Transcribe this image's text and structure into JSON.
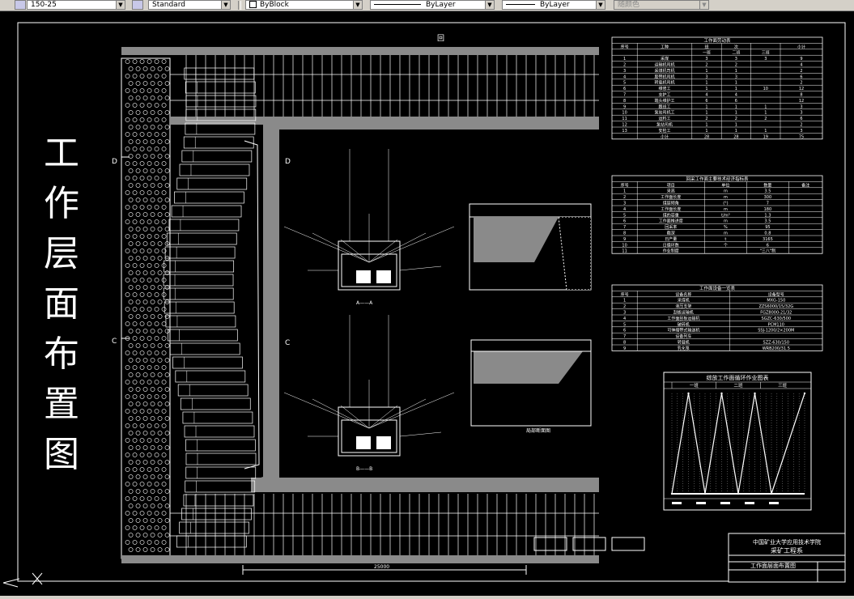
{
  "toolbar": {
    "dimstyle_value": "150-25",
    "textstyle_value": "Standard",
    "color_value": "ByBlock",
    "linetype_value": "ByLayer",
    "lineweight_value": "ByLayer",
    "plotstyle_value": "随颜色"
  },
  "drawing": {
    "vertical_title": [
      "工",
      "作",
      "层",
      "面",
      "布",
      "置",
      "图"
    ],
    "section_marks": [
      "D",
      "D",
      "C",
      "C"
    ],
    "top_mark": "回",
    "dim_bottom": "25000",
    "section_label_a": "A——A",
    "section_label_b": "B——B",
    "side_label": "局部断面图",
    "colors": {
      "bg": "#000000",
      "line": "#ffffff",
      "wall": "#8a8a8a",
      "toolbar": "#d4d0c8"
    }
  },
  "table1": {
    "title": "工作面劳动表",
    "headers": [
      "序号",
      "工种",
      "班",
      "次",
      "",
      "小计"
    ],
    "subheaders": [
      "一班",
      "二班",
      "三班"
    ],
    "rows": [
      [
        "1",
        "采煤",
        "3",
        "3",
        "3",
        "9"
      ],
      [
        "2",
        "运输机司机",
        "2",
        "2",
        "",
        "4"
      ],
      [
        "3",
        "采煤机司机",
        "1",
        "1",
        "",
        "2"
      ],
      [
        "4",
        "胶带机司机",
        "3",
        "3",
        "",
        "6"
      ],
      [
        "5",
        "转载机司机",
        "1",
        "1",
        "",
        "2"
      ],
      [
        "6",
        "维修工",
        "1",
        "1",
        "10",
        "12"
      ],
      [
        "7",
        "支护工",
        "4",
        "4",
        "",
        "8"
      ],
      [
        "8",
        "端头维护工",
        "6",
        "6",
        "",
        "12"
      ],
      [
        "9",
        "跟班工",
        "1",
        "1",
        "1",
        "3"
      ],
      [
        "10",
        "泵站司机工",
        "1",
        "1",
        "1",
        "3"
      ],
      [
        "11",
        "运料工",
        "2",
        "2",
        "2",
        "6"
      ],
      [
        "12",
        "泵站司机",
        "1",
        "1",
        "",
        "2"
      ],
      [
        "13",
        "安检工",
        "1",
        "1",
        "1",
        "3"
      ],
      [
        "",
        "小计",
        "28",
        "28",
        "19",
        "75"
      ]
    ]
  },
  "table2": {
    "title": "回采工作面主要技术经济指标表",
    "headers": [
      "序号",
      "项目",
      "单位",
      "数量",
      "备注"
    ],
    "rows": [
      [
        "1",
        "采高",
        "m",
        "3.5",
        ""
      ],
      [
        "2",
        "工作面长度",
        "m",
        "300",
        ""
      ],
      [
        "3",
        "煤层倾角",
        "(°)",
        "7",
        ""
      ],
      [
        "4",
        "工作面长度",
        "m",
        "180",
        ""
      ],
      [
        "5",
        "煤的容重",
        "t/m³",
        "1.3",
        ""
      ],
      [
        "6",
        "工作面推进度",
        "m",
        "3.5",
        ""
      ],
      [
        "7",
        "回采率",
        "%",
        "95",
        ""
      ],
      [
        "8",
        "截深",
        "m",
        "0.8",
        ""
      ],
      [
        "9",
        "日产量",
        "t",
        "3165",
        ""
      ],
      [
        "10",
        "日循环数",
        "个",
        "6",
        ""
      ],
      [
        "11",
        "作业制度",
        "",
        "\"三八\"制",
        ""
      ]
    ]
  },
  "table3": {
    "title": "工作面设备一览表",
    "headers": [
      "序号",
      "设备名称",
      "设备型号"
    ],
    "rows": [
      [
        "1",
        "采煤机",
        "MXG-150"
      ],
      [
        "2",
        "液压支架",
        "ZZS6000/15/32G"
      ],
      [
        "3",
        "刮板运输机",
        "FGZ8000-21/32"
      ],
      [
        "4",
        "工作面刮板运输机",
        "SGZC-630/500"
      ],
      [
        "5",
        "破碎机",
        "PCM110"
      ],
      [
        "6",
        "可伸缩带式输送机",
        "SSJ-1200/2×200M"
      ],
      [
        "7",
        "设备列车",
        ""
      ],
      [
        "8",
        "转载机",
        "SZZ-630/150"
      ],
      [
        "9",
        "乳化泵",
        "WRB200/31.5"
      ]
    ]
  },
  "chart": {
    "title": "综放工作面循环作业图表",
    "shift_labels": [
      "一班",
      "二班",
      "三班"
    ]
  },
  "chart_data": {
    "type": "line",
    "title": "综放工作面循环作业图表",
    "x": [
      0,
      3,
      6,
      9,
      12,
      15,
      18,
      24
    ],
    "series": [
      {
        "values": [
          0,
          1,
          0,
          1,
          0,
          1,
          0,
          1
        ]
      }
    ],
    "xlabel": "",
    "ylabel": ""
  },
  "titleblock": {
    "school": "中国矿业大学应用技术学院",
    "dept": "采矿工程系",
    "drawing_name": "工作面层面布置图"
  }
}
